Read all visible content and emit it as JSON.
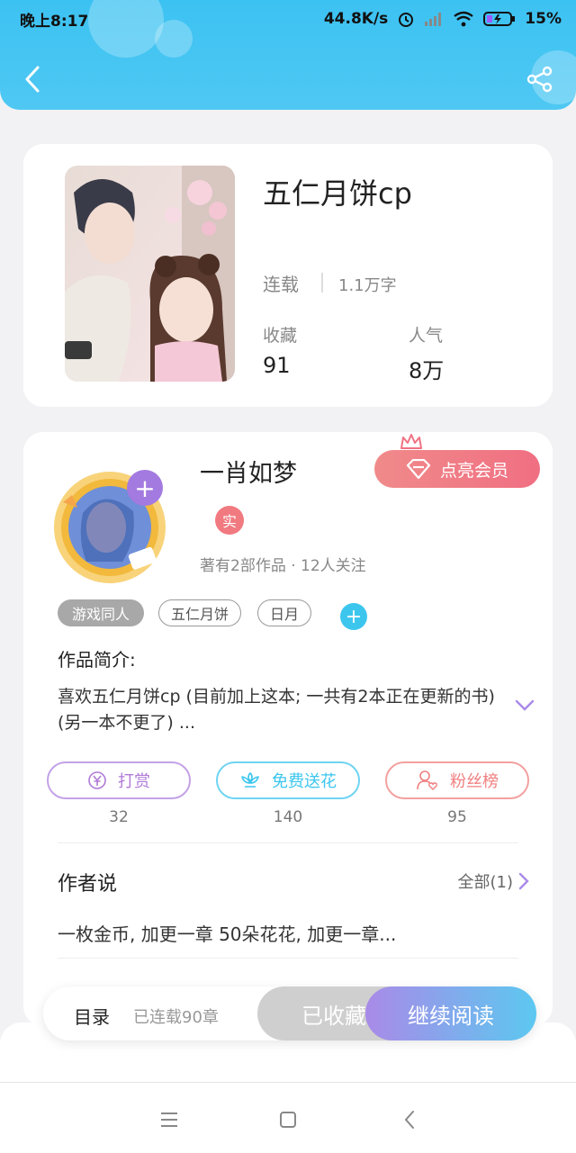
{
  "status_bar": {
    "time": "晚上8:17",
    "speed": "44.8K/s",
    "battery": "15%"
  },
  "book": {
    "title": "五仁月饼cp",
    "status": "连载",
    "word_count": "1.1万字",
    "stats": [
      {
        "label": "收藏",
        "value": "91"
      },
      {
        "label": "人气",
        "value": "8万"
      }
    ]
  },
  "author": {
    "name": "一肖如梦",
    "verified_badge": "实",
    "meta": "著有2部作品 · 12人关注",
    "vip_button": "点亮会员"
  },
  "tags": [
    "游戏同人",
    "五仁月饼",
    "日月"
  ],
  "intro": {
    "title": "作品简介:",
    "text": "喜欢五仁月饼cp (目前加上这本; 一共有2本正在更新的书)(另一本不更了) ..."
  },
  "actions": [
    {
      "label": "打赏",
      "count": "32",
      "color": "#b07ad8"
    },
    {
      "label": "免费送花",
      "count": "140",
      "color": "#3cc6ee"
    },
    {
      "label": "粉丝榜",
      "count": "95",
      "color": "#f08080"
    }
  ],
  "author_says": {
    "title": "作者说",
    "all_label": "全部(1)",
    "text": "一枚金币, 加更一章 50朵花花, 加更一章..."
  },
  "bottom_bar": {
    "toc_label": "目录",
    "toc_info": "已连载90章",
    "collected_label": "已收藏",
    "continue_label": "继续阅读"
  },
  "colors": {
    "header": "#3cc2f2",
    "vip": "#f07282",
    "accent_cyan": "#3cc6ee",
    "accent_purple": "#a98ae8"
  }
}
